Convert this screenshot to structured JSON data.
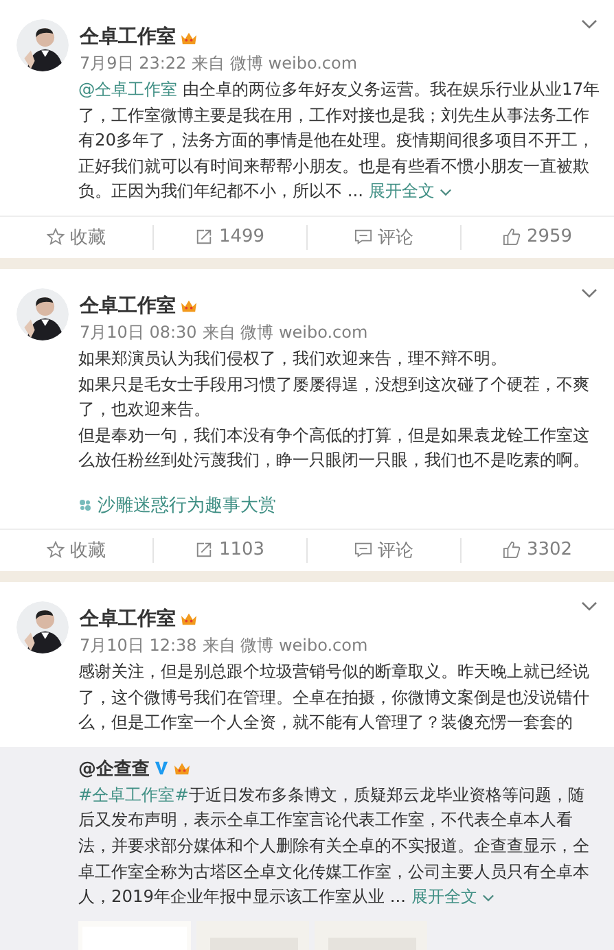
{
  "posts": [
    {
      "author": "仝卓工作室",
      "time": "7月9日 23:22",
      "source": "来自 微博 weibo.com",
      "mention": "@仝卓工作室",
      "body": " 由仝卓的两位多年好友义务运营。我在娱乐行业从业17年了，工作室微博主要是我在用，工作对接也是我；刘先生从事法务工作有20多年了，法务方面的事情是他在处理。疫情期间很多项目不开工，正好我们就可以有时间来帮帮小朋友。也是有些看不惯小朋友一直被欺负。正因为我们年纪都不小，所以不 ... ",
      "expand": "展开全文",
      "actions": {
        "favorite": "收藏",
        "reposts": "1499",
        "comment": "评论",
        "likes": "2959"
      }
    },
    {
      "author": "仝卓工作室",
      "time": "7月10日 08:30",
      "source": "来自 微博 weibo.com",
      "paragraphs": [
        "如果郑演员认为我们侵权了，我们欢迎来告，理不辩不明。",
        "如果只是毛女士手段用习惯了屡屡得逞，没想到这次碰了个硬茬，不爽了，也欢迎来告。",
        "但是奉劝一句，我们本没有争个高低的打算，但是如果袁龙铨工作室这么放任粉丝到处污蔑我们，睁一只眼闭一只眼，我们也不是吃素的啊。"
      ],
      "topic": "沙雕迷惑行为趣事大赏",
      "actions": {
        "favorite": "收藏",
        "reposts": "1103",
        "comment": "评论",
        "likes": "3302"
      }
    },
    {
      "author": "仝卓工作室",
      "time": "7月10日 12:38",
      "source": "来自 微博 weibo.com",
      "paragraphs": [
        "感谢关注，但是别总跟个垃圾营销号似的断章取义。昨天晚上就已经说了，这个微博号我们在管理。仝卓在拍摄，你微博文案倒是也没说错什么，但是工作室一个人全资，就不能有人管理了？装傻充愣一套套的"
      ],
      "repost": {
        "author": "@企查查",
        "hashtag": "#仝卓工作室#",
        "body": "于近日发布多条博文，质疑郑云龙毕业资格等问题，随后又发布声明，表示仝卓工作室言论代表工作室，不代表仝卓本人看法，并要求部分媒体和个人删除有关仝卓的不实报道。企查查显示，仝卓工作室全称为古塔区仝卓文化传媒工作室，公司主要人员只有仝卓本人，2019年企业年报中显示该工作室从业 ... ",
        "expand": "展开全文"
      }
    }
  ]
}
